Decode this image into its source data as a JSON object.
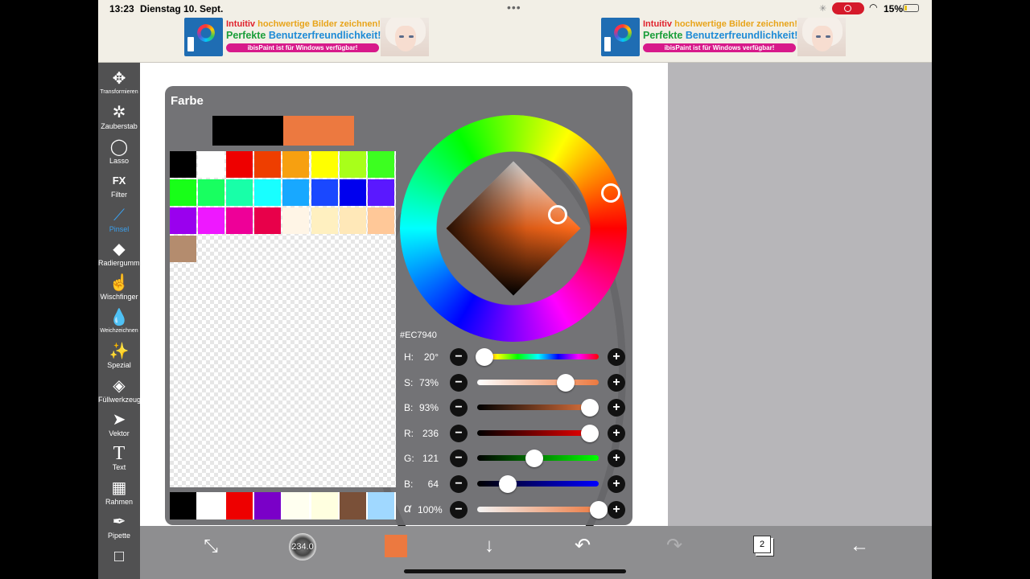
{
  "status_bar": {
    "time": "13:23",
    "date": "Dienstag 10. Sept.",
    "battery": "15%"
  },
  "ads": [
    {
      "line1_a": "Intuitiv ",
      "line1_b": "hochwertige Bilder zeichnen!",
      "line2_a": "Perfekte ",
      "line2_b": "Benutzerfreundlichkeit!",
      "line3": "ibisPaint ist für Windows verfügbar!"
    },
    {
      "line1_a": "Intuitiv ",
      "line1_b": "hochwertige Bilder zeichnen!",
      "line2_a": "Perfekte ",
      "line2_b": "Benutzerfreundlichkeit!",
      "line3": "ibisPaint ist für Windows verfügbar!"
    }
  ],
  "toolbar": [
    {
      "id": "transform",
      "icon": "move-arrows-icon",
      "glyph": "✥",
      "label": "Transformieren",
      "small": true,
      "active": false
    },
    {
      "id": "magic-wand",
      "icon": "magic-wand-icon",
      "glyph": "✲",
      "label": "Zauberstab",
      "small": false,
      "active": false
    },
    {
      "id": "lasso",
      "icon": "lasso-icon",
      "glyph": "◯",
      "label": "Lasso",
      "small": false,
      "active": false
    },
    {
      "id": "filter",
      "icon": "fx-filter-icon",
      "glyph": "FX",
      "label": "Filter",
      "small": false,
      "active": false
    },
    {
      "id": "brush",
      "icon": "brush-icon",
      "glyph": "⟋",
      "label": "Pinsel",
      "small": false,
      "active": true
    },
    {
      "id": "eraser",
      "icon": "eraser-icon",
      "glyph": "◆",
      "label": "Radiergummi",
      "small": false,
      "active": false
    },
    {
      "id": "smudge",
      "icon": "smudge-finger-icon",
      "glyph": "☝",
      "label": "Wischfinger",
      "small": false,
      "active": false
    },
    {
      "id": "blur",
      "icon": "water-drop-icon",
      "glyph": "💧",
      "label": "Weichzeichnen",
      "small": true,
      "active": false
    },
    {
      "id": "special",
      "icon": "special-wand-icon",
      "glyph": "✨",
      "label": "Spezial",
      "small": false,
      "active": false
    },
    {
      "id": "fill",
      "icon": "fill-bucket-icon",
      "glyph": "◈",
      "label": "Füllwerkzeug",
      "small": false,
      "active": false
    },
    {
      "id": "vector",
      "icon": "vector-cursor-icon",
      "glyph": "➤",
      "label": "Vektor",
      "small": false,
      "active": false
    },
    {
      "id": "text",
      "icon": "text-tool-icon",
      "glyph": "T",
      "label": "Text",
      "small": false,
      "active": false
    },
    {
      "id": "frame",
      "icon": "frame-panels-icon",
      "glyph": "▦",
      "label": "Rahmen",
      "small": false,
      "active": false
    },
    {
      "id": "eyedropper",
      "icon": "eyedropper-icon",
      "glyph": "✒",
      "label": "Pipette",
      "small": false,
      "active": false
    },
    {
      "id": "canvas-tool",
      "icon": "canvas-square-icon",
      "glyph": "□",
      "label": "",
      "small": false,
      "active": false
    }
  ],
  "color_panel": {
    "title": "Farbe",
    "current_colors": [
      "#000000",
      "#EC7940"
    ],
    "swatches": [
      [
        "#000000",
        "#ffffff",
        "#ee0000",
        "#ee3e00",
        "#f7a010",
        "#ffff00",
        "#a8ff1a",
        "#3cff20"
      ],
      [
        "#18ff18",
        "#18ff60",
        "#18ffa8",
        "#18ffff",
        "#18a8ff",
        "#1a48ff",
        "#0000ee",
        "#5a18ff"
      ],
      [
        "#9a00ee",
        "#ee18ff",
        "#ee0098",
        "#e8004a",
        "#fff5e6",
        "#fff0c0",
        "#ffe8b8",
        "#ffc898"
      ],
      [
        "#b48c6e"
      ]
    ],
    "recent": [
      "#000000",
      "#ffffff",
      "#ee0000",
      "#7a00c8",
      "#fffff0",
      "#ffffe0",
      "#7a5038",
      "#a0d8ff"
    ],
    "hex": "#EC7940",
    "sliders": [
      {
        "label": "H:",
        "value": "20°",
        "position": 0.06,
        "track": "linear-gradient(90deg,#ff0000,#ffff00,#00ff00,#00ffff,#0000ff,#ff00ff,#ff0000)"
      },
      {
        "label": "S:",
        "value": "73%",
        "position": 0.73,
        "track": "linear-gradient(90deg,#ffffff,#ec7940)"
      },
      {
        "label": "B:",
        "value": "93%",
        "position": 0.93,
        "track": "linear-gradient(90deg,#000000,#ec7940)"
      },
      {
        "label": "R:",
        "value": "236",
        "position": 0.925,
        "track": "linear-gradient(90deg,#000000,#ff0000)"
      },
      {
        "label": "G:",
        "value": "121",
        "position": 0.47,
        "track": "linear-gradient(90deg,#000000,#00ff00)"
      },
      {
        "label": "B:",
        "value": "64",
        "position": 0.25,
        "track": "linear-gradient(90deg,#000000,#0000ff)"
      },
      {
        "label": "α",
        "value": "100%",
        "position": 1.0,
        "track": "linear-gradient(90deg,#f4f4f4,#ec7940)"
      }
    ],
    "minus_glyph": "−",
    "plus_glyph": "+"
  },
  "bottom_bar": {
    "transform_glyph": "⤡",
    "brush_size": "234.0",
    "current_color": "#EC7940",
    "down_glyph": "↓",
    "undo_glyph": "↶",
    "redo_glyph": "↷",
    "layers_count": "2",
    "back_glyph": "←"
  }
}
